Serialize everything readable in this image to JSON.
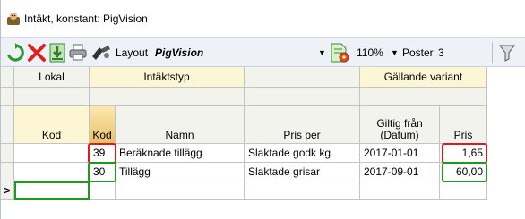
{
  "window": {
    "title": "Intäkt, konstant: PigVision"
  },
  "toolbar": {
    "layout_label": "Layout",
    "layout_value": "PigVision",
    "zoom_value": "110%",
    "records_label": "Poster",
    "records_value": "3"
  },
  "grid": {
    "group_headers": {
      "lokal": "Lokal",
      "intaktstyp": "Intäktstyp",
      "gallande": "Gällande variant"
    },
    "column_headers": {
      "lokal_kod": "Kod",
      "kod": "Kod",
      "namn": "Namn",
      "pris_per": "Pris per",
      "giltig_fran": "Giltig från",
      "giltig_fran_sub": "(Datum)",
      "pris": "Pris"
    },
    "rows": [
      {
        "lokal_kod": "",
        "kod": "39",
        "namn": "Beräknade tillägg",
        "pris_per": "Slaktade godk kg",
        "giltig_fran": "2017-01-01",
        "pris": "1,65"
      },
      {
        "lokal_kod": "",
        "kod": "30",
        "namn": "Tillägg",
        "pris_per": "Slaktade grisar",
        "giltig_fran": "2017-09-01",
        "pris": "60,00"
      }
    ],
    "new_row_indicator": ">"
  },
  "colors": {
    "highlight_red": "#e01919",
    "highlight_green": "#1e9a1e",
    "header_yellow": "#fdf6d4",
    "toolbar_bg": "#eef2f8"
  }
}
